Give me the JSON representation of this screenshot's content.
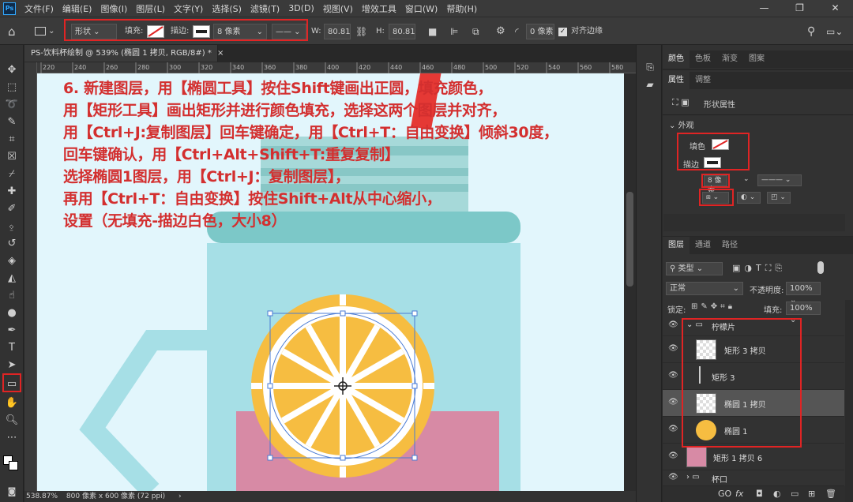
{
  "app": {
    "logo": "Ps"
  },
  "menu": [
    "文件(F)",
    "编辑(E)",
    "图像(I)",
    "图层(L)",
    "文字(Y)",
    "选择(S)",
    "滤镜(T)",
    "3D(D)",
    "视图(V)",
    "增效工具",
    "窗口(W)",
    "帮助(H)"
  ],
  "window_controls": {
    "minimize": "—",
    "restore": "❐",
    "close": "✕"
  },
  "options": {
    "shape_mode": "形状",
    "fill_label": "填充:",
    "stroke_label": "描边:",
    "stroke_size": "8 像素",
    "w_label": "W:",
    "w_value": "80.81 像",
    "h_label": "H:",
    "h_value": "80.81 像",
    "radius_value": "0 像素",
    "align_edges": "对齐边缘"
  },
  "document": {
    "tab_title": "PS-饮料杯绘制 @ 539% (椭圆 1 拷贝, RGB/8#) *",
    "tab_close": "×",
    "ruler_ticks": [
      "220",
      "240",
      "260",
      "280",
      "300",
      "320",
      "340",
      "360",
      "380",
      "400",
      "420",
      "440",
      "460",
      "480",
      "500",
      "520",
      "540",
      "560",
      "580"
    ],
    "zoom": "538.87%",
    "doc_info": "800 像素 x 600 像素 (72 ppi)",
    "status_arrow": "›"
  },
  "instructions": [
    "6. 新建图层，用【椭圆工具】按住Shift键画出正圆，填充颜色，",
    "用【矩形工具】画出矩形并进行颜色填充，选择这两个图层并对齐，",
    "用【Ctrl+J:复制图层】回车键确定，用【Ctrl+T：自由变换】倾斜30度，",
    "回车键确认，用【Ctrl+Alt+Shift+T:重复复制】",
    "选择椭圆1图层，用【Ctrl+J：复制图层】，",
    "再用【Ctrl+T：自由变换】按住Shift+Alt从中心缩小，",
    "设置（无填充-描边白色，大小8）"
  ],
  "panels": {
    "color_tabs": [
      "颜色",
      "色板",
      "渐变",
      "图案"
    ],
    "prop_tabs": [
      "属性",
      "调整"
    ],
    "prop_type": "形状属性",
    "appearance": "外观",
    "fill": "填色",
    "stroke": "描边",
    "stroke_size": "8 像素",
    "layer_tabs": [
      "图层",
      "通道",
      "路径"
    ],
    "kind_filter": "类型",
    "blend_mode": "正常",
    "opacity_label": "不透明度:",
    "opacity": "100%",
    "lock_label": "锁定:",
    "fill_label": "填充:",
    "fill_value": "100%",
    "layers": [
      {
        "name": "柠檬片",
        "group": true
      },
      {
        "name": "矩形 3 拷贝"
      },
      {
        "name": "矩形 3"
      },
      {
        "name": "椭圆 1 拷贝",
        "selected": true
      },
      {
        "name": "椭圆 1"
      },
      {
        "name": "矩形 1 拷贝 6"
      },
      {
        "name": "杯口",
        "group": true
      }
    ],
    "bottom_icons": [
      "GO",
      "fx"
    ]
  },
  "colors": {
    "canvas_bg": "#e2f6fc",
    "orange": "#f6bd41",
    "cup": "#a6dfe6",
    "lid": "#7cc8c8",
    "pink": "#d78aa5",
    "straw": "#e53935",
    "instruction": "#d32f2f",
    "highlight": "#e02424"
  }
}
